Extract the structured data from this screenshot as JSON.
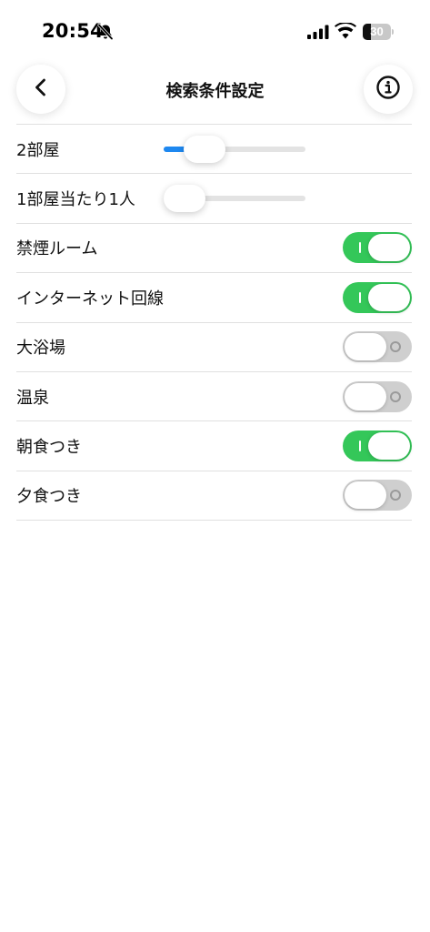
{
  "status_bar": {
    "time": "20:54",
    "battery_level": "30",
    "battery_fraction": 0.3,
    "icons": [
      "bell-slash-icon",
      "cellular-signal-icon",
      "wifi-icon",
      "battery-icon"
    ]
  },
  "header": {
    "title": "検索条件設定",
    "back_icon": "chevron-left-icon",
    "info_icon": "info-circle-icon"
  },
  "settings": {
    "sliders": [
      {
        "label": "2部屋",
        "fraction": 0.2
      },
      {
        "label": "1部屋当たり1人",
        "fraction": 0.0
      }
    ],
    "toggles": [
      {
        "label": "禁煙ルーム",
        "on": true
      },
      {
        "label": "インターネット回線",
        "on": true
      },
      {
        "label": "大浴場",
        "on": false
      },
      {
        "label": "温泉",
        "on": false
      },
      {
        "label": "朝食つき",
        "on": true
      },
      {
        "label": "夕食つき",
        "on": false
      }
    ]
  },
  "colors": {
    "toggle_on": "#34c759",
    "toggle_off": "#cfcfcf",
    "slider_fill": "#1e88f0",
    "slider_track": "#e3e3e3"
  }
}
